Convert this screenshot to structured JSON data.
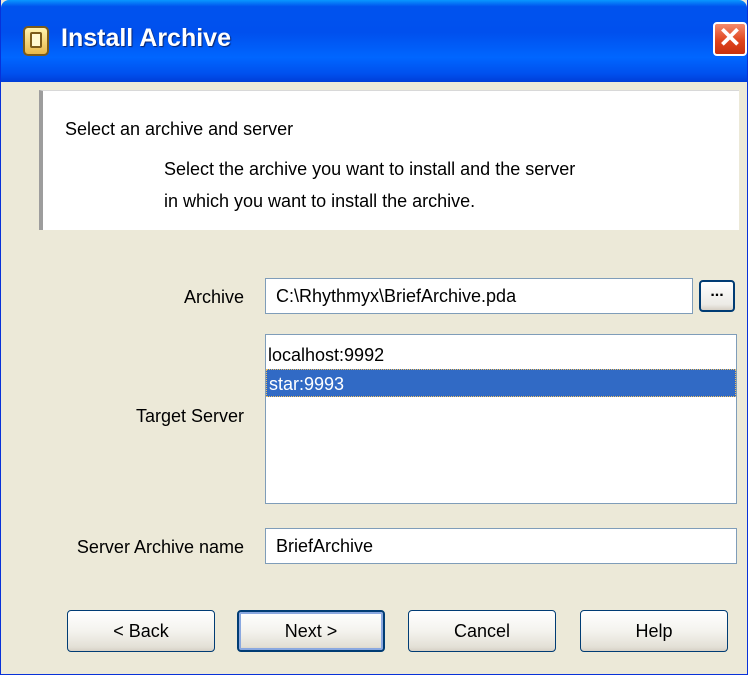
{
  "window": {
    "title": "Install Archive",
    "close_glyph": "✕"
  },
  "header": {
    "title": "Select an archive and server",
    "description_line1": "Select the archive you want to install and the server",
    "description_line2": "in which you want to install the archive."
  },
  "form": {
    "archive_label": "Archive",
    "archive_value": "C:\\Rhythmyx\\BriefArchive.pda",
    "browse_label": "...",
    "target_server_label": "Target Server",
    "servers": [
      {
        "label": "localhost:9992",
        "selected": false
      },
      {
        "label": "star:9993",
        "selected": true
      }
    ],
    "server_archive_name_label": "Server Archive name",
    "server_archive_name_value": "BriefArchive"
  },
  "buttons": {
    "back": "< Back",
    "next": "Next >",
    "cancel": "Cancel",
    "help": "Help"
  },
  "icons": {
    "app": "archive-icon",
    "close": "close-icon"
  },
  "colors": {
    "titlebar": "#0053ee",
    "selection": "#316ac5",
    "dialog_bg": "#ece9d8",
    "close_button": "#e0451e"
  }
}
